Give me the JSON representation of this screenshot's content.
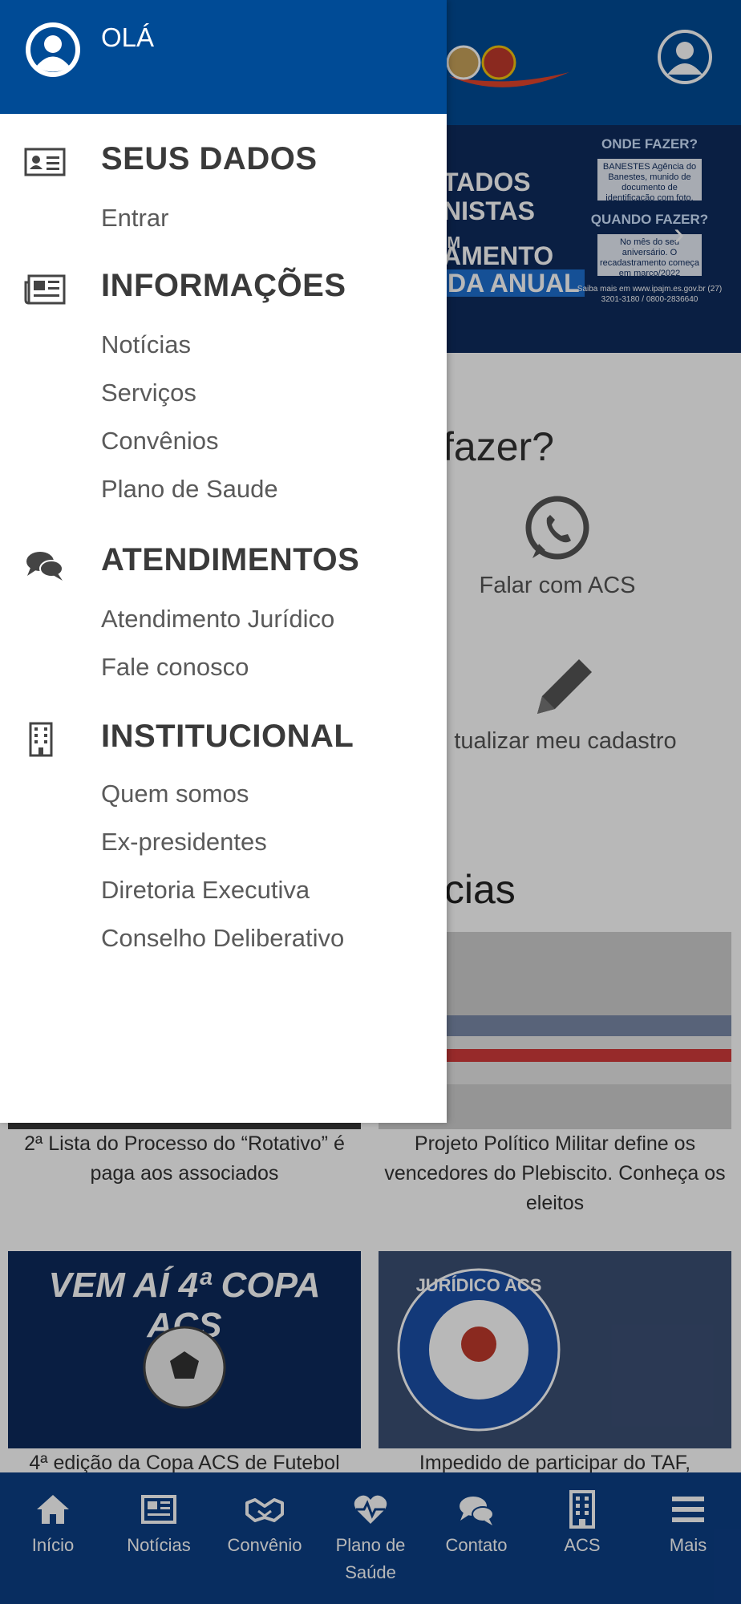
{
  "drawer": {
    "greeting": "OLÁ",
    "sections": [
      {
        "title": "SEUS DADOS",
        "icon": "id-card-icon",
        "links": [
          "Entrar"
        ]
      },
      {
        "title": "INFORMAÇÕES",
        "icon": "newspaper-icon",
        "links": [
          "Notícias",
          "Serviços",
          "Convênios",
          "Plano de Saude"
        ]
      },
      {
        "title": "ATENDIMENTOS",
        "icon": "chat-bubbles-icon",
        "links": [
          "Atendimento Jurídico",
          "Fale conosco"
        ]
      },
      {
        "title": "INSTITUCIONAL",
        "icon": "building-icon",
        "links": [
          "Quem somos",
          "Ex-presidentes",
          "Diretoria Executiva",
          "Conselho Deliberativo"
        ]
      }
    ]
  },
  "banner": {
    "lines": [
      "TADOS",
      "NISTAS",
      "IM",
      "AMENTO",
      "DA ANUAL"
    ],
    "where_heading": "ONDE FAZER?",
    "where_box": "BANESTES Agência do Banestes, munido de documento de identificação com foto.",
    "when_heading": "QUANDO FAZER?",
    "when_box": "No mês do seu aniversário. O recadastramento começa em março/2022",
    "info": "Saiba mais em www.ipajm.es.gov.br (27) 3201-3180 / 0800-2836640"
  },
  "main": {
    "question": "fazer?",
    "actions": [
      "Falar com ACS",
      "tualizar meu cadastro"
    ],
    "news_heading": "ícias",
    "news": [
      {
        "caption": "2ª Lista do Processo do “Rotativo” é paga aos associados"
      },
      {
        "caption": "Projeto Político Militar define os vencedores do Plebiscito. Conheça os eleitos"
      },
      {
        "caption": "4ª edição da Copa ACS de Futebol",
        "image_text": "VEM AÍ 4ª COPA ACS"
      },
      {
        "caption": "Impedido de participar do TAF,",
        "image_text": "JURÍDICO ACS"
      }
    ]
  },
  "bottom_nav": [
    {
      "label": "Início",
      "icon": "home-icon"
    },
    {
      "label": "Notícias",
      "icon": "newspaper-icon"
    },
    {
      "label": "Convênio",
      "icon": "handshake-icon"
    },
    {
      "label": "Plano de Saúde",
      "icon": "heart-pulse-icon"
    },
    {
      "label": "Contato",
      "icon": "chat-bubbles-icon"
    },
    {
      "label": "ACS",
      "icon": "building-icon"
    },
    {
      "label": "Mais",
      "icon": "menu-icon"
    }
  ],
  "colors": {
    "primary": "#004b96",
    "nav": "#0c3f86",
    "banner": "#0f2b5e"
  }
}
